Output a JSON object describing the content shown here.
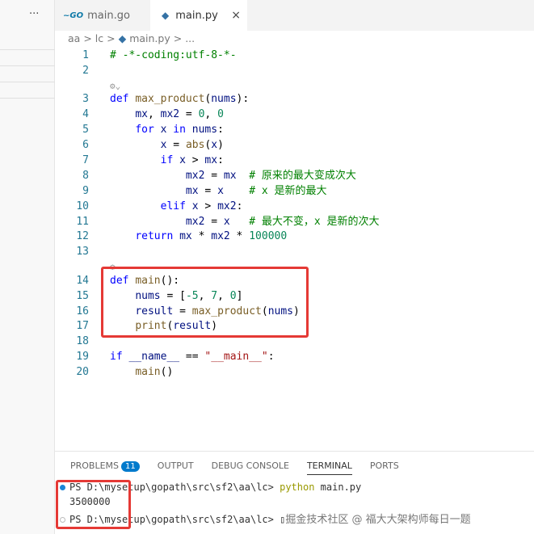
{
  "sidebar": {
    "more": "···"
  },
  "tabs": [
    {
      "label": "main.go",
      "icon": "go-icon"
    },
    {
      "label": "main.py",
      "icon": "python-icon",
      "close": "×"
    }
  ],
  "breadcrumb": [
    "aa",
    ">",
    "lc",
    ">",
    "main.py",
    ">",
    "..."
  ],
  "code": [
    {
      "n": "1",
      "t": [
        [
          "c",
          "# -*-coding:utf-8-*-"
        ]
      ]
    },
    {
      "n": "2",
      "t": []
    },
    {
      "lens": "⚙⌄"
    },
    {
      "n": "3",
      "t": [
        [
          "k",
          "def "
        ],
        [
          "f",
          "max_product"
        ],
        [
          "p",
          "("
        ],
        [
          "v",
          "nums"
        ],
        [
          "p",
          "):"
        ]
      ]
    },
    {
      "n": "4",
      "t": [
        [
          "p",
          "    "
        ],
        [
          "v",
          "mx"
        ],
        [
          "p",
          ", "
        ],
        [
          "v",
          "mx2"
        ],
        [
          "p",
          " = "
        ],
        [
          "n",
          "0"
        ],
        [
          "p",
          ", "
        ],
        [
          "n",
          "0"
        ]
      ]
    },
    {
      "n": "5",
      "t": [
        [
          "p",
          "    "
        ],
        [
          "k",
          "for "
        ],
        [
          "v",
          "x "
        ],
        [
          "k",
          "in "
        ],
        [
          "v",
          "nums"
        ],
        [
          "p",
          ":"
        ]
      ]
    },
    {
      "n": "6",
      "t": [
        [
          "p",
          "        "
        ],
        [
          "v",
          "x"
        ],
        [
          "p",
          " = "
        ],
        [
          "f",
          "abs"
        ],
        [
          "p",
          "("
        ],
        [
          "v",
          "x"
        ],
        [
          "p",
          ")"
        ]
      ]
    },
    {
      "n": "7",
      "t": [
        [
          "p",
          "        "
        ],
        [
          "k",
          "if "
        ],
        [
          "v",
          "x"
        ],
        [
          "p",
          " > "
        ],
        [
          "v",
          "mx"
        ],
        [
          "p",
          ":"
        ]
      ]
    },
    {
      "n": "8",
      "t": [
        [
          "p",
          "            "
        ],
        [
          "v",
          "mx2"
        ],
        [
          "p",
          " = "
        ],
        [
          "v",
          "mx"
        ],
        [
          "p",
          "  "
        ],
        [
          "c",
          "# 原来的最大变成次大"
        ]
      ]
    },
    {
      "n": "9",
      "t": [
        [
          "p",
          "            "
        ],
        [
          "v",
          "mx"
        ],
        [
          "p",
          " = "
        ],
        [
          "v",
          "x"
        ],
        [
          "p",
          "    "
        ],
        [
          "c",
          "# x 是新的最大"
        ]
      ]
    },
    {
      "n": "10",
      "t": [
        [
          "p",
          "        "
        ],
        [
          "k",
          "elif "
        ],
        [
          "v",
          "x"
        ],
        [
          "p",
          " > "
        ],
        [
          "v",
          "mx2"
        ],
        [
          "p",
          ":"
        ]
      ]
    },
    {
      "n": "11",
      "t": [
        [
          "p",
          "            "
        ],
        [
          "v",
          "mx2"
        ],
        [
          "p",
          " = "
        ],
        [
          "v",
          "x"
        ],
        [
          "p",
          "   "
        ],
        [
          "c",
          "# 最大不变，x 是新的次大"
        ]
      ]
    },
    {
      "n": "12",
      "t": [
        [
          "p",
          "    "
        ],
        [
          "k",
          "return "
        ],
        [
          "v",
          "mx"
        ],
        [
          "p",
          " * "
        ],
        [
          "v",
          "mx2"
        ],
        [
          "p",
          " * "
        ],
        [
          "n",
          "100000"
        ]
      ]
    },
    {
      "n": "13",
      "t": []
    },
    {
      "lens": "⚙"
    },
    {
      "n": "14",
      "t": [
        [
          "k",
          "def "
        ],
        [
          "f",
          "main"
        ],
        [
          "p",
          "():"
        ]
      ]
    },
    {
      "n": "15",
      "t": [
        [
          "p",
          "    "
        ],
        [
          "v",
          "nums"
        ],
        [
          "p",
          " = ["
        ],
        [
          "n",
          "-5"
        ],
        [
          "p",
          ", "
        ],
        [
          "n",
          "7"
        ],
        [
          "p",
          ", "
        ],
        [
          "n",
          "0"
        ],
        [
          "p",
          "]"
        ]
      ]
    },
    {
      "n": "16",
      "t": [
        [
          "p",
          "    "
        ],
        [
          "v",
          "result"
        ],
        [
          "p",
          " = "
        ],
        [
          "f",
          "max_product"
        ],
        [
          "p",
          "("
        ],
        [
          "v",
          "nums"
        ],
        [
          "p",
          ")"
        ]
      ]
    },
    {
      "n": "17",
      "t": [
        [
          "p",
          "    "
        ],
        [
          "f",
          "print"
        ],
        [
          "p",
          "("
        ],
        [
          "v",
          "result"
        ],
        [
          "p",
          ")"
        ]
      ]
    },
    {
      "n": "18",
      "t": []
    },
    {
      "n": "19",
      "t": [
        [
          "k",
          "if "
        ],
        [
          "v",
          "__name__"
        ],
        [
          "p",
          " == "
        ],
        [
          "s",
          "\"__main__\""
        ],
        [
          "p",
          ":"
        ]
      ]
    },
    {
      "n": "20",
      "t": [
        [
          "p",
          "    "
        ],
        [
          "f",
          "main"
        ],
        [
          "p",
          "()"
        ]
      ]
    }
  ],
  "panel": {
    "tabs": [
      "PROBLEMS",
      "OUTPUT",
      "DEBUG CONSOLE",
      "TERMINAL",
      "PORTS"
    ],
    "problems_count": "11",
    "active": "TERMINAL"
  },
  "terminal": {
    "prompt": "PS D:\\mysetup\\gopath\\src\\sf2\\aa\\lc> ",
    "command": "python",
    "args": " main.py",
    "output": "3500000",
    "cursor": "▯",
    "watermark": "掘金技术社区 @ 福大大架构师每日一题"
  },
  "colors": {
    "highlight": "#e53935",
    "accent": "#007acc"
  }
}
